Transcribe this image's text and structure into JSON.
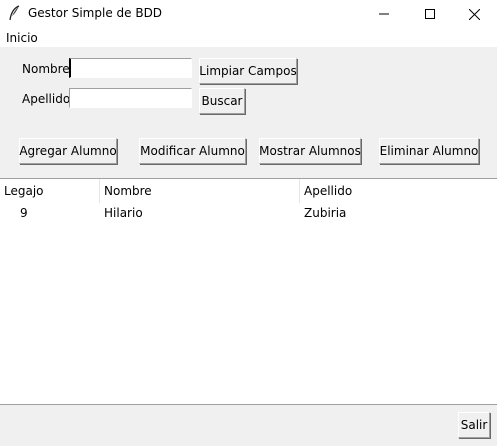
{
  "window": {
    "title": "Gestor Simple de BDD",
    "icon": "feather-icon"
  },
  "menu": {
    "items": [
      "Inicio"
    ]
  },
  "form": {
    "nombre_label": "Nombre",
    "nombre_value": "",
    "apellido_label": "Apellido",
    "apellido_value": "",
    "limpiar_label": "Limpiar Campos",
    "buscar_label": "Buscar"
  },
  "actions": {
    "agregar": "Agregar Alumno",
    "modificar": "Modificar Alumno",
    "mostrar": "Mostrar Alumnos",
    "eliminar": "Eliminar Alumno"
  },
  "table": {
    "columns": [
      "Legajo",
      "Nombre",
      "Apellido"
    ],
    "rows": [
      [
        "9",
        "Hilario",
        "Zubiria"
      ]
    ]
  },
  "footer": {
    "salir": "Salir"
  }
}
